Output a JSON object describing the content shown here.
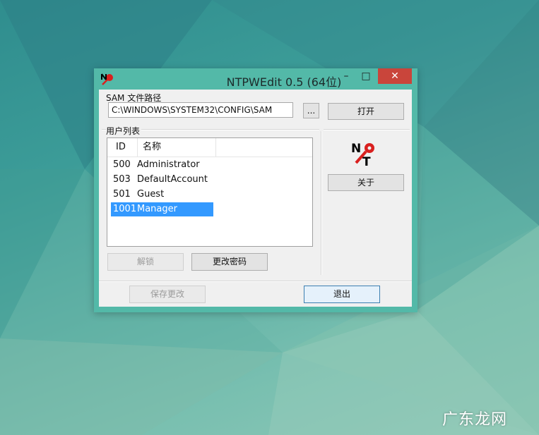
{
  "window": {
    "title": "NTPWEdit 0.5 (64位)",
    "minimize_glyph": "–",
    "maximize_glyph": "□",
    "close_glyph": "✕"
  },
  "sam": {
    "label": "SAM 文件路径",
    "path_value": "C:\\WINDOWS\\SYSTEM32\\CONFIG\\SAM",
    "browse_label": "...",
    "open_label": "打开"
  },
  "users": {
    "label": "用户列表",
    "columns": [
      "ID",
      "名称"
    ],
    "rows": [
      {
        "id": "500",
        "name": "Administrator"
      },
      {
        "id": "503",
        "name": "DefaultAccount"
      },
      {
        "id": "501",
        "name": "Guest"
      },
      {
        "id": "1001",
        "name": "Manager"
      }
    ],
    "selected_index": 3
  },
  "buttons": {
    "unlock": "解锁",
    "change_password": "更改密码",
    "about": "关于",
    "save": "保存更改",
    "exit": "退出"
  },
  "logo_letters": {
    "n": "N",
    "t": "T"
  },
  "watermark": "广东龙网",
  "colors": {
    "accent_frame": "#53b9a8",
    "close_button": "#c9453b",
    "selection": "#3399ff"
  }
}
